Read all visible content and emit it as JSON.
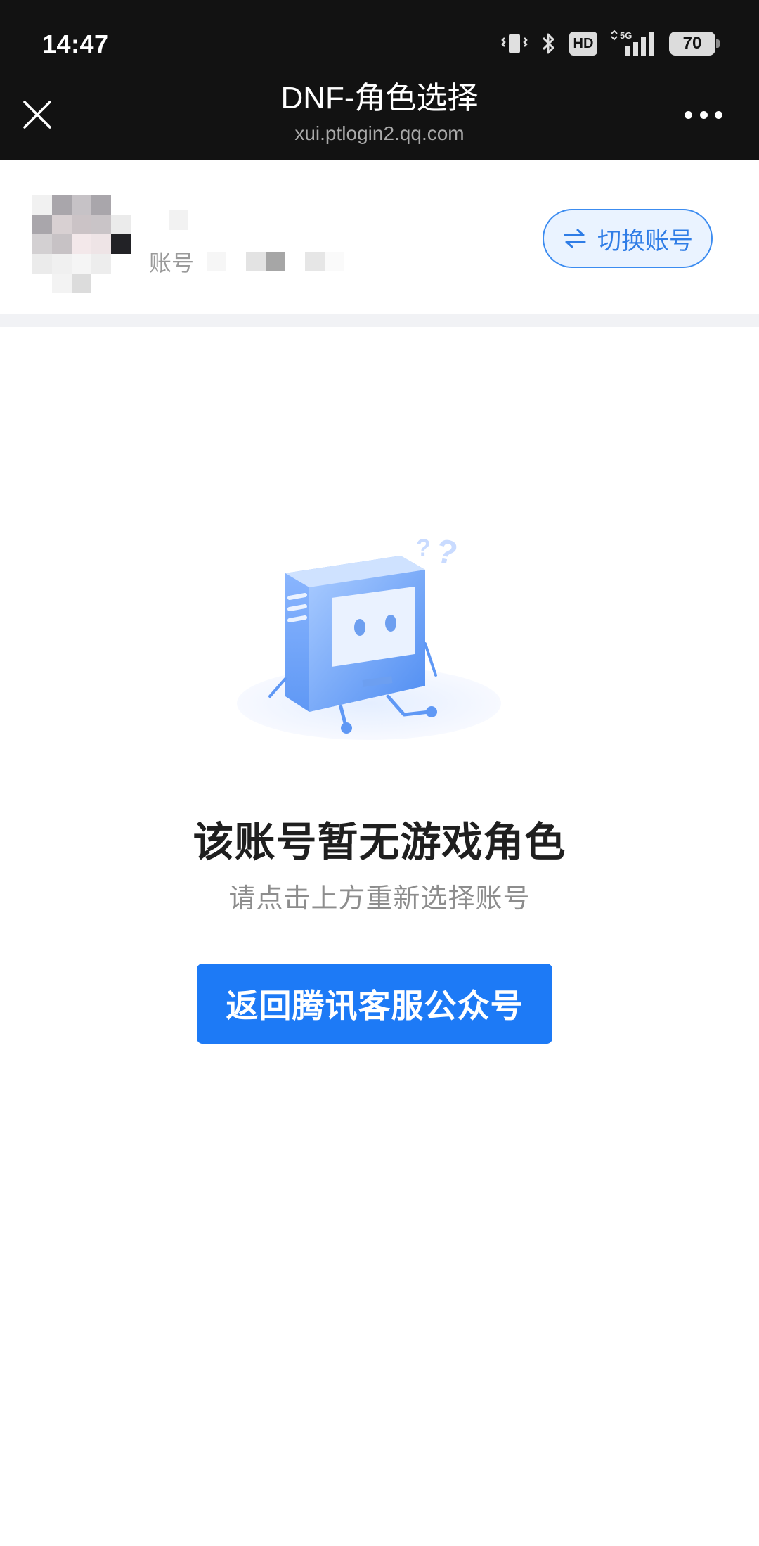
{
  "status_bar": {
    "time": "14:47",
    "network": "5G",
    "hd_label": "HD",
    "battery_level": "70"
  },
  "header": {
    "title": "DNF-角色选择",
    "url": "xui.ptlogin2.qq.com"
  },
  "account": {
    "label": "账号",
    "switch_label": "切换账号"
  },
  "empty_state": {
    "title": "该账号暂无游戏角色",
    "subtitle": "请点击上方重新选择账号",
    "button_label": "返回腾讯客服公众号"
  },
  "colors": {
    "header_bg": "#121212",
    "accent": "#1d7af6",
    "switch_bg": "#eaf3ff"
  }
}
